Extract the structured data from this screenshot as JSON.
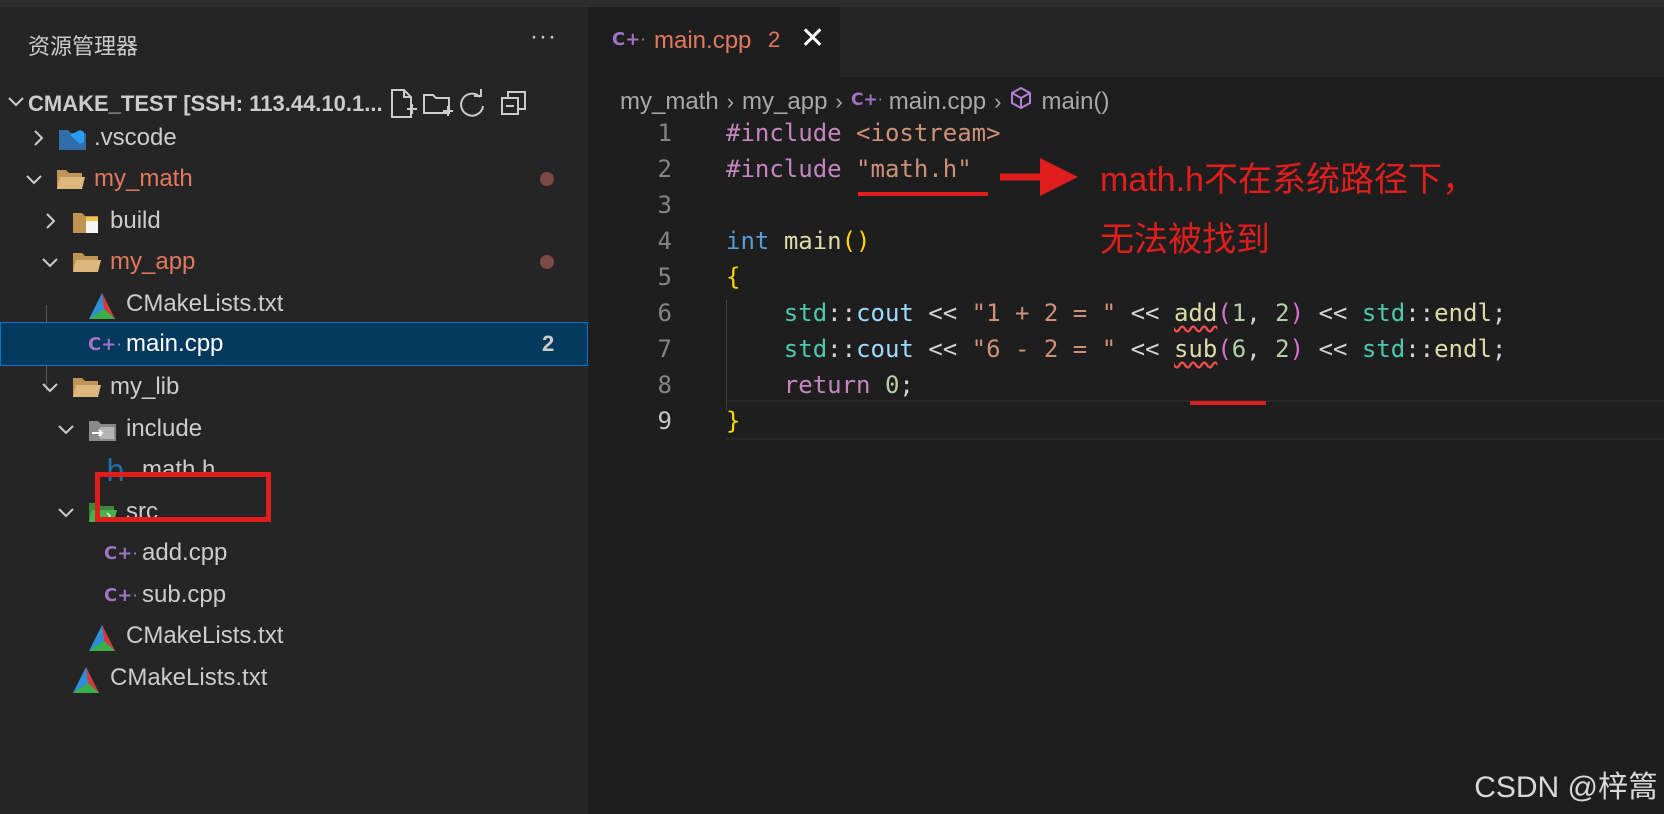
{
  "explorer": {
    "header": "资源管理器",
    "more": "···",
    "workspace": "CMAKE_TEST [SSH: 113.44.10.1...",
    "actions": [
      "new-file-icon",
      "new-folder-icon",
      "refresh-icon",
      "collapse-all-icon"
    ],
    "items": [
      {
        "label": ".vscode",
        "kind": "folder-vscode",
        "expanded": false
      },
      {
        "label": "my_math",
        "kind": "folder",
        "expanded": true,
        "modified": true
      },
      {
        "label": "build",
        "kind": "folder-build",
        "expanded": false
      },
      {
        "label": "my_app",
        "kind": "folder",
        "expanded": true,
        "modified": true
      },
      {
        "label": "CMakeLists.txt",
        "kind": "cmake"
      },
      {
        "label": "main.cpp",
        "kind": "cpp",
        "selected": true,
        "badge": "2"
      },
      {
        "label": "my_lib",
        "kind": "folder",
        "expanded": true
      },
      {
        "label": "include",
        "kind": "folder-include",
        "expanded": true
      },
      {
        "label": "math.h",
        "kind": "header",
        "highlighted": true
      },
      {
        "label": "src",
        "kind": "folder-src",
        "expanded": true
      },
      {
        "label": "add.cpp",
        "kind": "cpp"
      },
      {
        "label": "sub.cpp",
        "kind": "cpp"
      },
      {
        "label": "CMakeLists.txt",
        "kind": "cmake"
      },
      {
        "label": "CMakeLists.txt",
        "kind": "cmake"
      }
    ]
  },
  "tab": {
    "label": "main.cpp",
    "count": "2",
    "close": "✕"
  },
  "breadcrumb": [
    "my_math",
    "my_app",
    "main.cpp",
    "main()"
  ],
  "code": {
    "line_numbers": [
      "1",
      "2",
      "3",
      "4",
      "5",
      "6",
      "7",
      "8",
      "9"
    ],
    "current_line": "9"
  },
  "annotation": {
    "line1": "math.h不在系统路径下，",
    "line2": "无法被找到",
    "color": "#e01e1e"
  },
  "watermark": "CSDN @梓篙",
  "colors": {
    "modified": "#e2795f",
    "selection": "#04395e",
    "error_squiggle": "#f14c4c"
  }
}
